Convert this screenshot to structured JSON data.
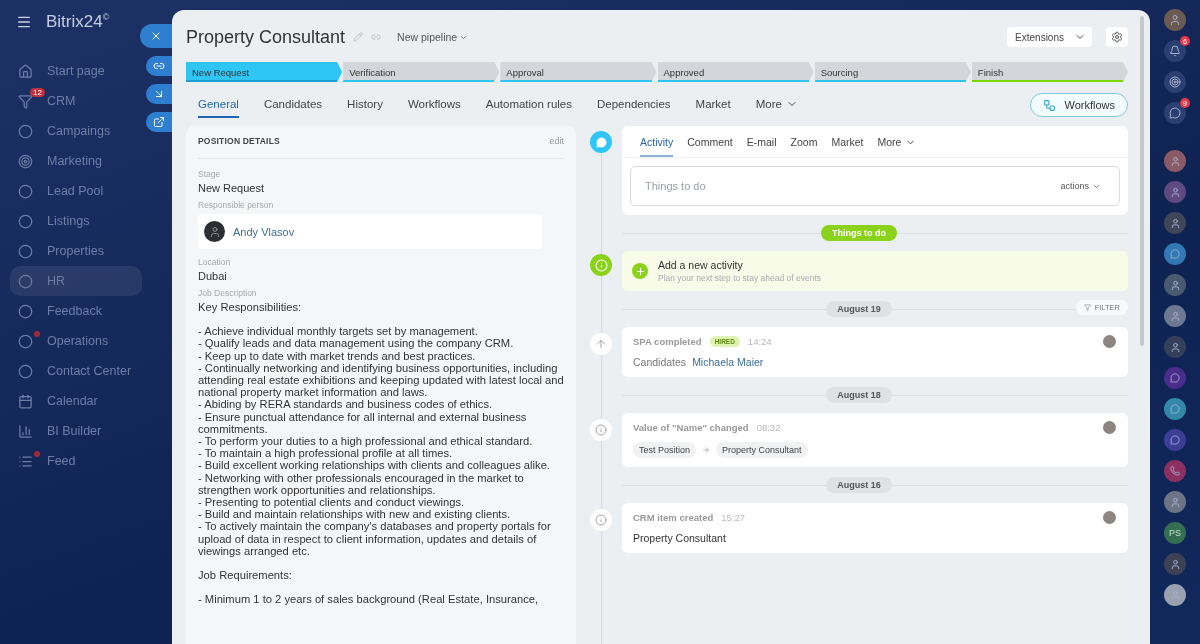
{
  "brand": {
    "name": "Bitrix24",
    "mark": "©"
  },
  "sidebar": {
    "items": [
      {
        "label": "Start page",
        "kind": "home",
        "selected": false
      },
      {
        "label": "CRM",
        "kind": "filter",
        "badge": "12",
        "selected": false
      },
      {
        "label": "Campaings",
        "kind": "circle",
        "selected": false
      },
      {
        "label": "Marketing",
        "kind": "target",
        "selected": false
      },
      {
        "label": "Lead Pool",
        "kind": "circle",
        "selected": false
      },
      {
        "label": "Listings",
        "kind": "circle",
        "selected": false
      },
      {
        "label": "Properties",
        "kind": "circle",
        "selected": false
      },
      {
        "label": "HR",
        "kind": "circle",
        "selected": true
      },
      {
        "label": "Feedback",
        "kind": "circle",
        "selected": false
      },
      {
        "label": "Operations",
        "kind": "circle",
        "alert": true,
        "selected": false
      },
      {
        "label": "Contact Center",
        "kind": "circle",
        "selected": false
      },
      {
        "label": "Calendar",
        "kind": "calendar",
        "selected": false
      },
      {
        "label": "BI Builder",
        "kind": "chart",
        "selected": false
      },
      {
        "label": "Feed",
        "kind": "list",
        "alert": true,
        "selected": false
      }
    ]
  },
  "slider_buttons": [
    {
      "kind": "close"
    },
    {
      "kind": "link"
    },
    {
      "kind": "minimize"
    },
    {
      "kind": "open"
    }
  ],
  "header": {
    "title": "Property Consultant",
    "pipeline": "New pipeline",
    "extensions": "Extensions"
  },
  "stages": [
    {
      "label": "New Request",
      "selected": true,
      "color": "#1a9fd0"
    },
    {
      "label": "Verification",
      "selected": false,
      "color": "#2fc6f6"
    },
    {
      "label": "Approval",
      "selected": false,
      "color": "#2fc6f6"
    },
    {
      "label": "Approved",
      "selected": false,
      "color": "#2fc6f6"
    },
    {
      "label": "Sourcing",
      "selected": false,
      "color": "#2fc6f6"
    },
    {
      "label": "Finish",
      "selected": false,
      "color": "#7bd500"
    }
  ],
  "tabs": [
    {
      "label": "General",
      "selected": true
    },
    {
      "label": "Candidates",
      "selected": false
    },
    {
      "label": "History",
      "selected": false
    },
    {
      "label": "Workflows",
      "selected": false
    },
    {
      "label": "Automation rules",
      "selected": false
    },
    {
      "label": "Dependencies",
      "selected": false
    },
    {
      "label": "Market",
      "selected": false
    },
    {
      "label": "More",
      "selected": false,
      "dropdown": true
    }
  ],
  "workflows_button": "Workflows",
  "details": {
    "title": "POSITION DETAILS",
    "edit": "edit",
    "fields": [
      {
        "kind": "text",
        "label": "Stage",
        "value": "New Request"
      },
      {
        "kind": "person",
        "label": "Responsible person",
        "value": "Andy Vlasov"
      },
      {
        "kind": "text",
        "label": "Location",
        "value": "Dubai"
      }
    ],
    "description_label": "Job Description",
    "description": [
      {
        "heading": "Key Responsibilities:",
        "items": [
          "- Achieve individual monthly targets set by management.",
          "- Qualify leads and data management using the company CRM.",
          "- Keep up to date with market trends and best practices.",
          "- Continually networking and identifying business opportunities, including attending real estate exhibitions and keeping updated with latest local and national property market information and laws.",
          "- Abiding by RERA standards and business codes of ethics.",
          "- Ensure punctual attendance for all internal and external business commitments.",
          "- To perform your duties to a high professional and ethical standard.",
          "- To maintain a high professional profile at all times.",
          "- Build excellent working relationships with clients and colleagues alike.",
          "- Networking with other professionals encouraged in the market to strengthen work opportunities and relationships.",
          "- Presenting to potential clients and conduct viewings.",
          "- Build and maintain relationships with new and existing clients.",
          "- To actively maintain the company's databases and property portals for upload of data in respect to client information, updates and details of viewings arranged etc."
        ]
      },
      {
        "heading": "Job Requirements:",
        "items": [
          "- Minimum 1 to 2 years of sales background (Real Estate, Insurance,"
        ]
      }
    ]
  },
  "activity": {
    "tabs": [
      {
        "label": "Activity",
        "selected": true
      },
      {
        "label": "Comment",
        "selected": false
      },
      {
        "label": "E-mail",
        "selected": false
      },
      {
        "label": "Zoom",
        "selected": false
      },
      {
        "label": "Market",
        "selected": false
      },
      {
        "label": "More",
        "selected": false,
        "dropdown": true
      }
    ],
    "placeholder": "Things to do",
    "actions": "actions"
  },
  "todo_label": "Things to do",
  "add_activity": {
    "title": "Add a new activity",
    "hint": "Plan your next step to stay ahead of events"
  },
  "filter": "FILTER",
  "timeline": [
    {
      "date": "August 19",
      "items": [
        {
          "kind": "moved",
          "title": "SPA completed",
          "badge": "HIRED",
          "time": "14:24",
          "prefix": "Candidates",
          "link": "Michaela Maier"
        }
      ]
    },
    {
      "date": "August 18",
      "items": [
        {
          "kind": "change",
          "title": "Value of \"Name\" changed",
          "time": "08:32",
          "from": "Test Position",
          "to": "Property Consultant"
        }
      ]
    },
    {
      "date": "August 16",
      "items": [
        {
          "kind": "created",
          "title": "CRM item created",
          "time": "15:27",
          "text": "Property Consultant"
        }
      ]
    }
  ],
  "right_bar": {
    "top": [
      {
        "kind": "avatar"
      },
      {
        "kind": "bell",
        "badge": "6"
      },
      {
        "kind": "target"
      },
      {
        "kind": "chat",
        "badge": "9"
      }
    ],
    "contacts": [
      {
        "kind": "avatar",
        "color": "#8a5a66"
      },
      {
        "kind": "avatar",
        "color": "#5e4a7e"
      },
      {
        "kind": "avatar",
        "color": "#3e4658"
      },
      {
        "kind": "icon",
        "color": "#3178b4"
      },
      {
        "kind": "avatar",
        "color": "#4c5a70"
      },
      {
        "kind": "avatar",
        "color": "#6e7890"
      },
      {
        "kind": "avatar",
        "color": "#34405a"
      },
      {
        "kind": "icon",
        "color": "#4a2c8a"
      },
      {
        "kind": "icon",
        "color": "#3288aa"
      },
      {
        "kind": "icon",
        "color": "#3c3e96"
      },
      {
        "kind": "icon",
        "color": "#8c3062"
      },
      {
        "kind": "avatar",
        "color": "#6c7486"
      },
      {
        "kind": "initials",
        "text": "PS",
        "color": "#356e50"
      },
      {
        "kind": "avatar",
        "color": "#3c4254"
      },
      {
        "kind": "avatar",
        "color": "#9aa0b0"
      }
    ]
  }
}
